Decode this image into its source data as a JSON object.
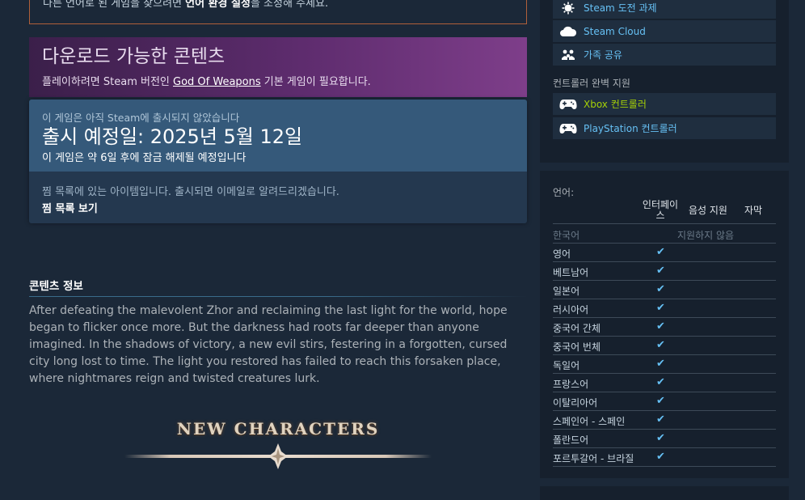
{
  "left": {
    "lang_notice_pre": "다른 언어로 된 게임을 찾으려면 ",
    "lang_notice_bold": "언어 환경 설정",
    "lang_notice_post": "을 조정해 주세요.",
    "dlc": {
      "title": "다운로드 가능한 콘텐츠",
      "sub_pre": "플레이하려면 Steam 버전인 ",
      "sub_link": "God Of Weapons",
      "sub_post": " 기본 게임이 필요합니다."
    },
    "release": {
      "not_released": "이 게임은 아직 Steam에 출시되지 않았습니다",
      "date": "출시 예정일: 2025년 5월 12일",
      "unlock": "이 게임은 약 6일 후에 잠금 해제될 예정입니다"
    },
    "wishlist": {
      "text": "찜 목록에 있는 아이템입니다. 출시되면 이메일로 알려드리겠습니다.",
      "link": "찜 목록 보기"
    },
    "about": {
      "heading": "콘텐츠 정보",
      "body": "After defeating the malevolent Zhor and reclaiming the last light for the world, hope began to flicker once more. But the darkness had roots far deeper than anyone imagined. In the shadows of victory, a new evil stirs, festering in a forgotten, cursed city long lost to time. The light you restored has failed to reach this forsaken place, where nightmares reign and twisted creatures lurk."
    },
    "banner": {
      "title": "NEW CHARACTERS"
    }
  },
  "features": [
    {
      "label": "Steam 도전 과제",
      "icon": "achievement-icon"
    },
    {
      "label": "Steam Cloud",
      "icon": "cloud-icon"
    },
    {
      "label": "가족 공유",
      "icon": "family-icon"
    }
  ],
  "controller_label": "컨트롤러 완벽 지원",
  "controllers": [
    {
      "label": "Xbox 컨트롤러",
      "icon": "gamepad-icon",
      "color": "#a4d007"
    },
    {
      "label": "PlayStation 컨트롤러",
      "icon": "gamepad-icon",
      "color": "#66c0f4"
    }
  ],
  "languages": {
    "title": "언어:",
    "headers": [
      "인터페이스",
      "음성 지원",
      "자막"
    ],
    "unsupported_text": "지원하지 않음",
    "rows": [
      {
        "name": "한국어",
        "interface": false,
        "unsupported": true
      },
      {
        "name": "영어",
        "interface": true
      },
      {
        "name": "베트남어",
        "interface": true
      },
      {
        "name": "일본어",
        "interface": true
      },
      {
        "name": "러시아어",
        "interface": true
      },
      {
        "name": "중국어 간체",
        "interface": true
      },
      {
        "name": "중국어 번체",
        "interface": true
      },
      {
        "name": "독일어",
        "interface": true
      },
      {
        "name": "프랑스어",
        "interface": true
      },
      {
        "name": "이탈리아어",
        "interface": true
      },
      {
        "name": "스페인어 - 스페인",
        "interface": true
      },
      {
        "name": "폴란드어",
        "interface": true
      },
      {
        "name": "포르투갈어 - 브라질",
        "interface": true
      }
    ],
    "check_glyph": "✔"
  }
}
